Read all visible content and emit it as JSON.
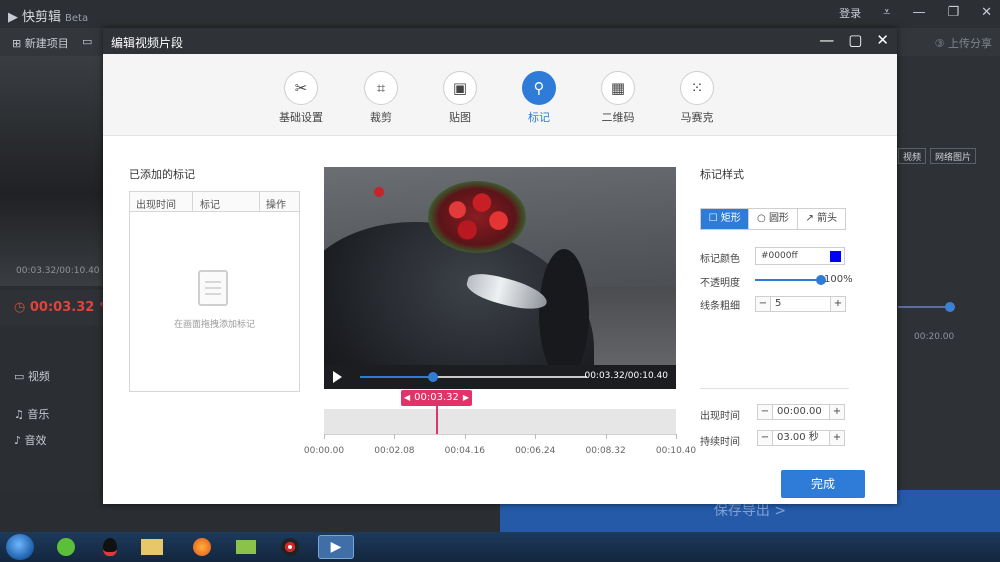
{
  "app": {
    "name": "快剪辑",
    "badge": "Beta",
    "login": "登录",
    "toolbar_new": "新建项目",
    "upload": "上传分享",
    "bg_time_left": "00:03.32/00:10.40",
    "current_time": "00:03.32",
    "tracks": [
      "视频",
      "音乐",
      "音效"
    ],
    "right_buttons": [
      "视频",
      "网络图片"
    ],
    "right_time": "00:20.00",
    "export": "保存导出 >"
  },
  "dialog": {
    "title": "编辑视频片段",
    "tabs": [
      {
        "label": "基础设置",
        "icon": "scissors-icon"
      },
      {
        "label": "裁剪",
        "icon": "crop-icon"
      },
      {
        "label": "贴图",
        "icon": "image-icon"
      },
      {
        "label": "标记",
        "icon": "pin-icon"
      },
      {
        "label": "二维码",
        "icon": "qrcode-icon"
      },
      {
        "label": "马赛克",
        "icon": "mosaic-icon"
      }
    ],
    "active_tab": 3,
    "left_title": "已添加的标记",
    "table_headers": [
      "出现时间",
      "标记",
      "操作"
    ],
    "empty_hint": "在画面拖拽添加标记",
    "player": {
      "time": "00:03.32/00:10.40",
      "progress": 0.32
    },
    "playhead": "00:03.32",
    "ruler_labels": [
      "00:00.00",
      "00:02.08",
      "00:04.16",
      "00:06.24",
      "00:08.32",
      "00:10.40"
    ],
    "style_title": "标记样式",
    "shapes": [
      "矩形",
      "圆形",
      "箭头"
    ],
    "color_label": "标记颜色",
    "color_value": "#0000ff",
    "opacity_label": "不透明度",
    "opacity_value": "100%",
    "line_label": "线条粗细",
    "line_value": "5",
    "appear_label": "出现时间",
    "appear_value": "00:00.00",
    "duration_label": "持续时间",
    "duration_value": "03.00 秒",
    "done": "完成"
  }
}
